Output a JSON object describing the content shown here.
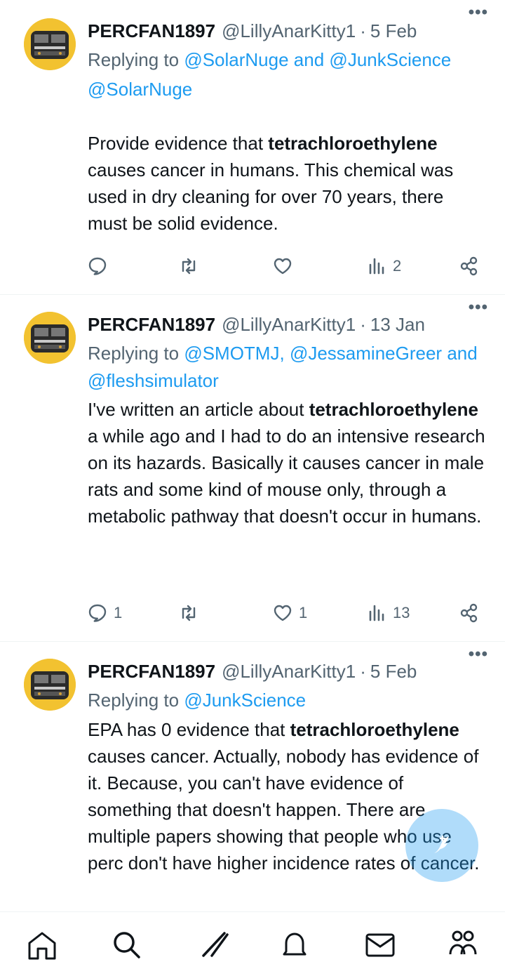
{
  "tweets": [
    {
      "name": "PERCFAN1897",
      "handle": "@LillyAnarKitty1",
      "separator": "·",
      "date": "5 Feb",
      "more_icon": "more-dots-icon",
      "replying_prefix": "Replying to",
      "replying_to_1": "@SolarNuge",
      "replying_joiner_1": "and",
      "replying_to_2": "@JunkScience",
      "text_lines": [
        "@SolarNuge"
      ],
      "body_pre": "Provide evidence that ",
      "body_bold": "tetrachloroethylene",
      "body_post": " causes cancer in humans. This chemical was used in dry cleaning for over 70 years, there must be solid evidence.",
      "replies": "",
      "retweets": "",
      "likes": "",
      "views": "2"
    },
    {
      "name": "PERCFAN1897",
      "handle": "@LillyAnarKitty1",
      "separator": "·",
      "date": "13 Jan",
      "replying_prefix": "Replying to",
      "replying_to_1": "@SMOTMJ",
      "replying_joiner_1": ",",
      "replying_to_2": "@JessamineGreer",
      "replying_joiner_2": "and",
      "replying_to_3": "@fleshsimulator",
      "body_pre": "I've written an article about ",
      "body_bold": "tetrachloroethylene",
      "body_post": " a while ago and I had to do an intensive research on its hazards. Basically it causes cancer in male rats and some kind of mouse only, through a metabolic pathway that doesn't occur in humans.",
      "replies": "1",
      "retweets": "",
      "likes": "1",
      "views": "13"
    },
    {
      "name": "PERCFAN1897",
      "handle": "@LillyAnarKitty1",
      "separator": "·",
      "date": "5 Feb",
      "replying_prefix": "Replying to",
      "replying_to_1": "@JunkScience",
      "body_pre": "EPA has 0 evidence that ",
      "body_bold": "tetrachloroethylene",
      "body_post": " causes cancer. Actually, nobody has evidence of it. Because, you can't have evidence of something that doesn't happen. There are multiple papers showing that people who use perc don't have higher incidence rates of cancer."
    }
  ],
  "more_dots": "•••",
  "colors": {
    "link": "#1d9bf0",
    "muted": "#536471",
    "text": "#0f1419",
    "avatar_bg": "#f2c230",
    "fab": "#1d9bf0"
  },
  "icons": {
    "reply": "reply-icon",
    "retweet": "retweet-icon",
    "like": "heart-icon",
    "views": "views-icon",
    "share": "share-icon",
    "compose": "compose-icon"
  },
  "bottom_nav": [
    "home-icon",
    "search-icon",
    "grok-icon",
    "notifications-icon",
    "messages-icon",
    "communities-icon"
  ]
}
